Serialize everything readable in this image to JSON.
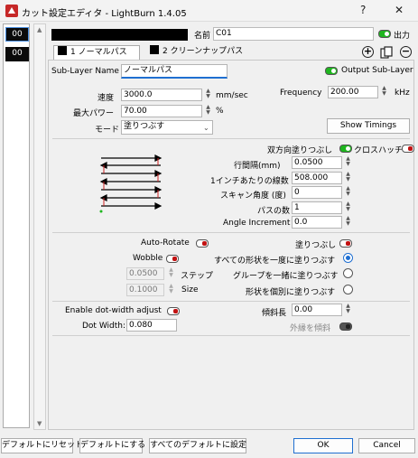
{
  "window": {
    "title": "カット設定エディタ - LightBurn 1.4.05",
    "help_icon": "?",
    "close_icon": "✕"
  },
  "layers": [
    "00",
    "00"
  ],
  "header": {
    "name_label": "名前",
    "name_value": "C01",
    "output_label": "出力"
  },
  "tabs": [
    {
      "label": "1 ノーマルパス"
    },
    {
      "label": "2 クリーンナップパス"
    }
  ],
  "sublayer": {
    "name_label": "Sub-Layer Name",
    "name_value": "ノーマルパス",
    "output_label": "Output Sub-Layer"
  },
  "speed": {
    "label": "速度",
    "value": "3000.0",
    "unit": "mm/sec"
  },
  "frequency": {
    "label": "Frequency",
    "value": "200.00",
    "unit": "kHz"
  },
  "max_power": {
    "label": "最大パワー",
    "value": "70.00",
    "unit": "%"
  },
  "mode": {
    "label": "モード",
    "value": "塗りつぶす"
  },
  "show_timings_button": "Show Timings",
  "fill_options": {
    "bidirectional_label": "双方向塗りつぶし",
    "crosshatch_label": "クロスハッチ"
  },
  "fields": [
    {
      "label": "行間隔(mm)",
      "value": "0.0500"
    },
    {
      "label": "1インチあたりの線数",
      "value": "508.000"
    },
    {
      "label": "スキャン角度 (度)",
      "value": "0"
    },
    {
      "label": "パスの数",
      "value": "1"
    },
    {
      "label": "Angle Increment",
      "value": "0.0"
    }
  ],
  "auto_rotate": {
    "label": "Auto-Rotate"
  },
  "fill_toggle": {
    "label": "塗りつぶし"
  },
  "wobble": {
    "label": "Wobble",
    "step_label": "ステップ",
    "step_value": "0.0500",
    "size_label": "Size",
    "size_value": "0.1000"
  },
  "fill_shapes": {
    "all_at_once": "すべての形状を一度に塗りつぶす",
    "groups_together": "グループを一緒に塗りつぶす",
    "individually": "形状を個別に塗りつぶす"
  },
  "dot": {
    "enable_label": "Enable dot-width adjust",
    "width_label": "Dot Width:",
    "width_value": "0.080"
  },
  "bevel": {
    "length_label": "傾斜長",
    "length_value": "0.00",
    "outline_label": "外縁を傾斜"
  },
  "footer": {
    "reset_default": "デフォルトにリセット",
    "make_default": "デフォルトにする",
    "set_all_default": "すべてのデフォルトに設定",
    "ok": "OK",
    "cancel": "Cancel"
  }
}
